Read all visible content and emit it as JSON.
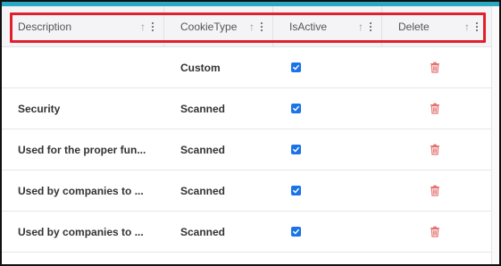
{
  "grid": {
    "columns": [
      {
        "key": "description",
        "label": "Description"
      },
      {
        "key": "cookieType",
        "label": "CookieType"
      },
      {
        "key": "isActive",
        "label": "IsActive"
      },
      {
        "key": "delete",
        "label": "Delete"
      }
    ],
    "sort_icon": "arrow-up-icon",
    "menu_icon": "kebab-menu-icon",
    "rows": [
      {
        "description": "",
        "cookieType": "Custom",
        "isActive": true
      },
      {
        "description": "Security",
        "cookieType": "Scanned",
        "isActive": true
      },
      {
        "description": "Used for the proper fun...",
        "cookieType": "Scanned",
        "isActive": true
      },
      {
        "description": "Used by companies to ...",
        "cookieType": "Scanned",
        "isActive": true
      },
      {
        "description": "Used by companies to ...",
        "cookieType": "Scanned",
        "isActive": true
      }
    ]
  },
  "colors": {
    "accent_bar": "#2aa8c4",
    "highlight": "#e0202a",
    "checkbox": "#1a73e8",
    "delete_icon": "#e57373"
  }
}
